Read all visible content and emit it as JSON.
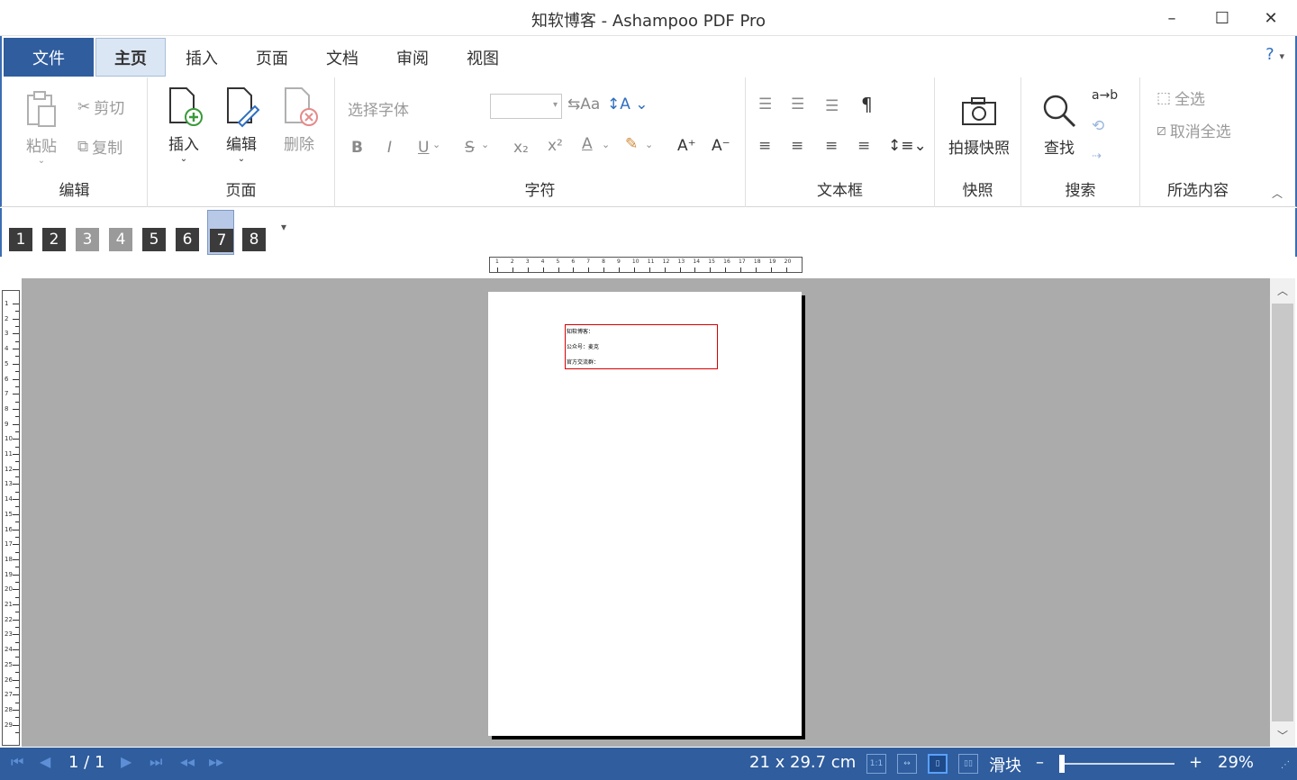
{
  "window": {
    "title": "知软博客 - Ashampoo PDF Pro",
    "minimize": "–",
    "maximize": "☐",
    "close": "✕"
  },
  "tabs": {
    "file": "文件",
    "items": [
      "主页",
      "插入",
      "页面",
      "文档",
      "审阅",
      "视图"
    ],
    "active": "主页",
    "help": "?"
  },
  "ribbon": {
    "edit": {
      "label": "编辑",
      "paste": "粘贴",
      "cut": "剪切",
      "copy": "复制"
    },
    "page": {
      "label": "页面",
      "insert": "插入",
      "edit": "编辑",
      "delete": "删除"
    },
    "font": {
      "label": "字符",
      "font_placeholder": "选择字体",
      "size_value": "",
      "bold": "B",
      "italic": "I",
      "underline": "U",
      "strike": "S",
      "subscript": "x₂",
      "superscript": "x²",
      "color": "A",
      "grow": "A⁺",
      "shrink": "A⁻"
    },
    "textbox": {
      "label": "文本框",
      "pilcrow": "¶"
    },
    "snapshot": {
      "label": "快照",
      "button": "拍摄快照"
    },
    "search": {
      "label": "搜索",
      "button": "查找",
      "replace": "a→b"
    },
    "selection": {
      "label": "所选内容",
      "select_all": "全选",
      "deselect_all": "取消全选"
    }
  },
  "quick_access": {
    "badges": [
      "1",
      "2",
      "3",
      "4",
      "5",
      "6",
      "7",
      "8"
    ],
    "selected": "7",
    "more": "▾"
  },
  "ruler": {
    "h_numbers": [
      "1",
      "2",
      "3",
      "4",
      "5",
      "6",
      "7",
      "8",
      "9",
      "10",
      "11",
      "12",
      "13",
      "14",
      "15",
      "16",
      "17",
      "18",
      "19",
      "20"
    ],
    "v_numbers": [
      "1",
      "2",
      "3",
      "4",
      "5",
      "6",
      "7",
      "8",
      "9",
      "10",
      "11",
      "12",
      "13",
      "14",
      "15",
      "16",
      "17",
      "18",
      "19",
      "20",
      "21",
      "22",
      "23",
      "24",
      "25",
      "26",
      "27",
      "28",
      "29"
    ]
  },
  "document": {
    "lines": [
      "知软博客：",
      "公众号：麦克",
      "官方交流群："
    ]
  },
  "status": {
    "page_indicator": "1 / 1",
    "page_size": "21 x 29.7 cm",
    "slider_label": "滑块",
    "zoom_minus": "–",
    "zoom_plus": "+",
    "zoom_level": "29%",
    "zoom_fraction": 0.0
  },
  "colors": {
    "accent": "#2f5d9e",
    "workspace": "#ababab",
    "textbox_border": "#d40000"
  }
}
